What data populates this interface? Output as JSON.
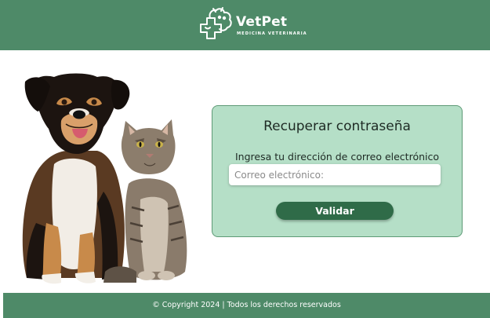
{
  "header": {
    "brand": "VetPet",
    "tagline": "MEDICINA VETERINARIA",
    "logo_icon": "pet-cross-logo-icon"
  },
  "hero": {
    "image": "dog-and-cat-photo"
  },
  "recover": {
    "title": "Recuperar contraseña",
    "label": "Ingresa tu dirección de correo electrónico",
    "email_placeholder": "Correo electrónico:",
    "email_value": "",
    "submit_label": "Validar"
  },
  "footer": {
    "text": "© Copyright 2024 | Todos los derechos reservados"
  },
  "colors": {
    "header_bg": "#4e8a68",
    "card_bg": "#b5dfc7",
    "button_bg": "#2f6b48"
  }
}
